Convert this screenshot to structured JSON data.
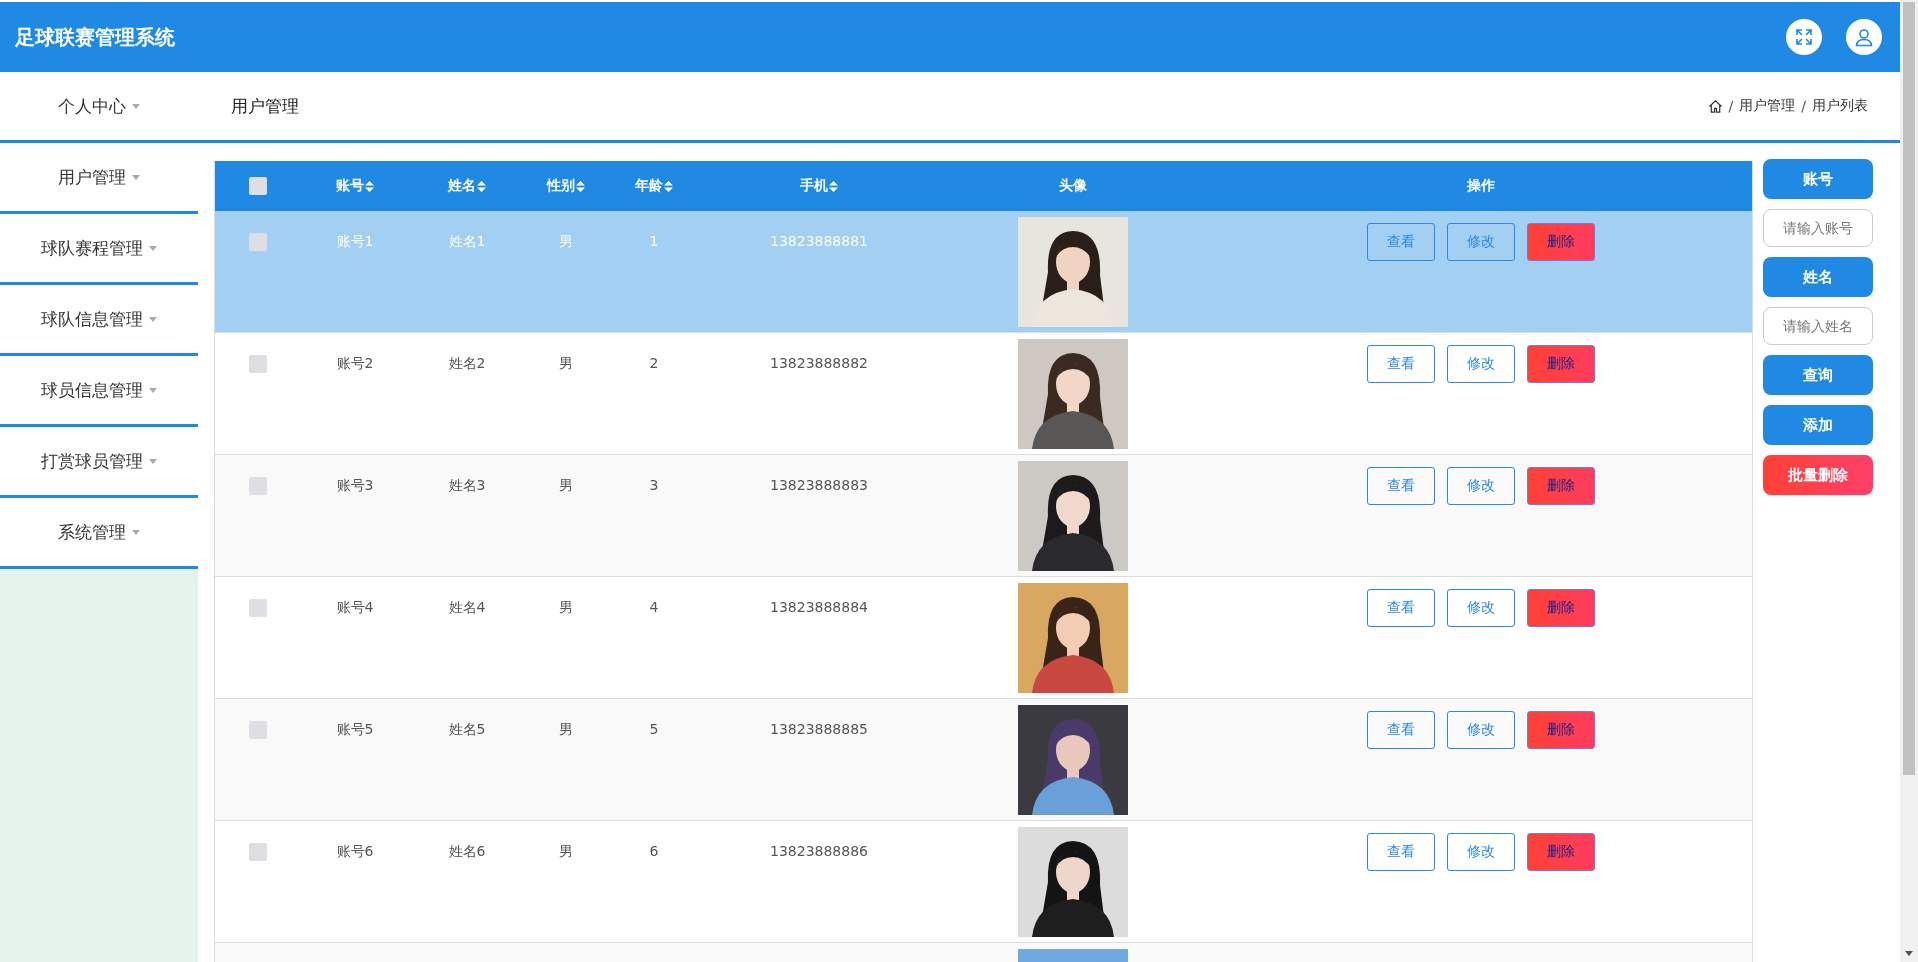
{
  "app_title": "足球联赛管理系统",
  "sidebar": {
    "items": [
      {
        "label": "个人中心"
      },
      {
        "label": "用户管理"
      },
      {
        "label": "球队赛程管理"
      },
      {
        "label": "球队信息管理"
      },
      {
        "label": "球员信息管理"
      },
      {
        "label": "打赏球员管理"
      },
      {
        "label": "系统管理"
      }
    ]
  },
  "page_title": "用户管理",
  "breadcrumb": [
    {
      "separator": "/",
      "label": "用户管理"
    },
    {
      "separator": "/",
      "label": "用户列表"
    }
  ],
  "table": {
    "all_checked": false,
    "columns": [
      {
        "label": "账号",
        "sortable": true
      },
      {
        "label": "姓名",
        "sortable": true
      },
      {
        "label": "性别",
        "sortable": true
      },
      {
        "label": "年龄",
        "sortable": true
      },
      {
        "label": "手机",
        "sortable": true
      },
      {
        "label": "头像",
        "sortable": false
      },
      {
        "label": "操作",
        "sortable": false
      }
    ],
    "rows": [
      {
        "selected": true,
        "checked": false,
        "cells": [
          "账号1",
          "姓名1",
          "男",
          "1",
          "13823888881"
        ],
        "avatar": {
          "kind": "picture"
        },
        "actions": [
          {
            "label": "查看",
            "kind": "view"
          },
          {
            "label": "修改",
            "kind": "edit"
          },
          {
            "label": "删除",
            "kind": "delete"
          }
        ]
      },
      {
        "selected": false,
        "checked": false,
        "cells": [
          "账号2",
          "姓名2",
          "男",
          "2",
          "13823888882"
        ],
        "avatar": {
          "kind": "picture"
        },
        "actions": [
          {
            "label": "查看",
            "kind": "view"
          },
          {
            "label": "修改",
            "kind": "edit"
          },
          {
            "label": "删除",
            "kind": "delete"
          }
        ]
      },
      {
        "selected": false,
        "checked": false,
        "cells": [
          "账号3",
          "姓名3",
          "男",
          "3",
          "13823888883"
        ],
        "avatar": {
          "kind": "picture"
        },
        "actions": [
          {
            "label": "查看",
            "kind": "view"
          },
          {
            "label": "修改",
            "kind": "edit"
          },
          {
            "label": "删除",
            "kind": "delete"
          }
        ]
      },
      {
        "selected": false,
        "checked": false,
        "cells": [
          "账号4",
          "姓名4",
          "男",
          "4",
          "13823888884"
        ],
        "avatar": {
          "kind": "picture"
        },
        "actions": [
          {
            "label": "查看",
            "kind": "view"
          },
          {
            "label": "修改",
            "kind": "edit"
          },
          {
            "label": "删除",
            "kind": "delete"
          }
        ]
      },
      {
        "selected": false,
        "checked": false,
        "cells": [
          "账号5",
          "姓名5",
          "男",
          "5",
          "13823888885"
        ],
        "avatar": {
          "kind": "picture"
        },
        "actions": [
          {
            "label": "查看",
            "kind": "view"
          },
          {
            "label": "修改",
            "kind": "edit"
          },
          {
            "label": "删除",
            "kind": "delete"
          }
        ]
      },
      {
        "selected": false,
        "checked": false,
        "cells": [
          "账号6",
          "姓名6",
          "男",
          "6",
          "13823888886"
        ],
        "avatar": {
          "kind": "picture"
        },
        "actions": [
          {
            "label": "查看",
            "kind": "view"
          },
          {
            "label": "修改",
            "kind": "edit"
          },
          {
            "label": "删除",
            "kind": "delete"
          }
        ]
      }
    ],
    "partial_row": {
      "kind": "picture"
    }
  },
  "search_panel": [
    {
      "kind": "label",
      "text": "账号"
    },
    {
      "kind": "input",
      "placeholder": "请输入账号"
    },
    {
      "kind": "label",
      "text": "姓名"
    },
    {
      "kind": "input",
      "placeholder": "请输入姓名"
    },
    {
      "kind": "button",
      "text": "查询"
    },
    {
      "kind": "button",
      "text": "添加"
    },
    {
      "kind": "danger",
      "text": "批量删除"
    }
  ]
}
